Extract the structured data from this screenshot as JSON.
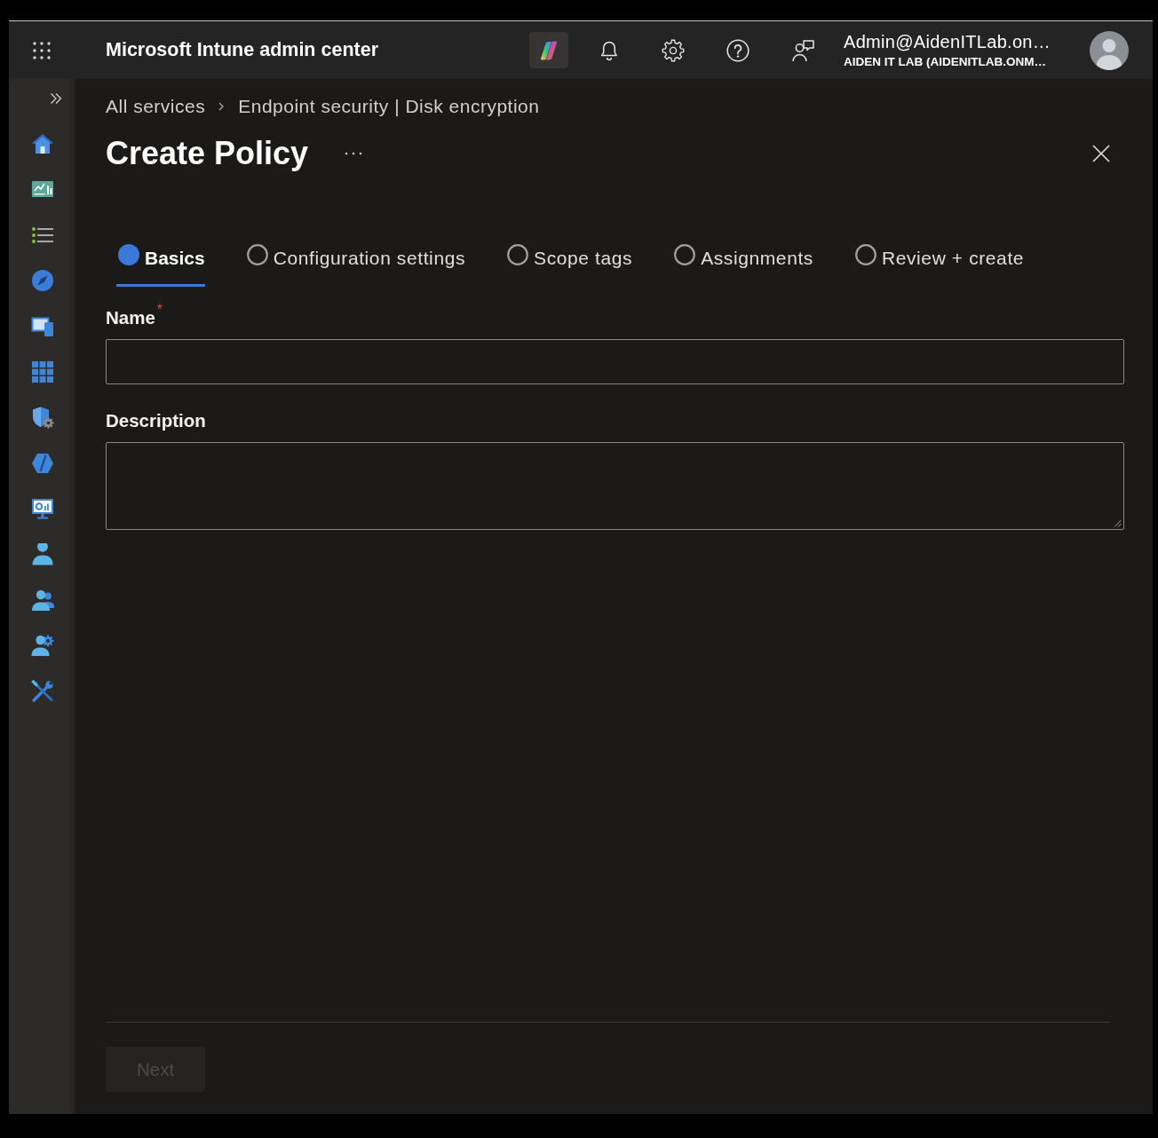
{
  "topbar": {
    "title": "Microsoft Intune admin center",
    "account": {
      "user": "Admin@AidenITLab.on…",
      "tenant": "AIDEN IT LAB (AIDENITLAB.ONM…"
    }
  },
  "breadcrumb": [
    {
      "label": "All services"
    },
    {
      "label": "Endpoint security | Disk encryption"
    }
  ],
  "page": {
    "title": "Create Policy"
  },
  "tabs": [
    {
      "label": "Basics",
      "selected": true
    },
    {
      "label": "Configuration settings",
      "selected": false
    },
    {
      "label": "Scope tags",
      "selected": false
    },
    {
      "label": "Assignments",
      "selected": false
    },
    {
      "label": "Review + create",
      "selected": false
    }
  ],
  "fields": [
    {
      "kind": "text",
      "label": "Name",
      "required_mark": "*"
    },
    {
      "kind": "textarea",
      "label": "Description"
    }
  ],
  "footer": {
    "buttons": [
      {
        "label": "Next",
        "disabled": true
      }
    ]
  }
}
